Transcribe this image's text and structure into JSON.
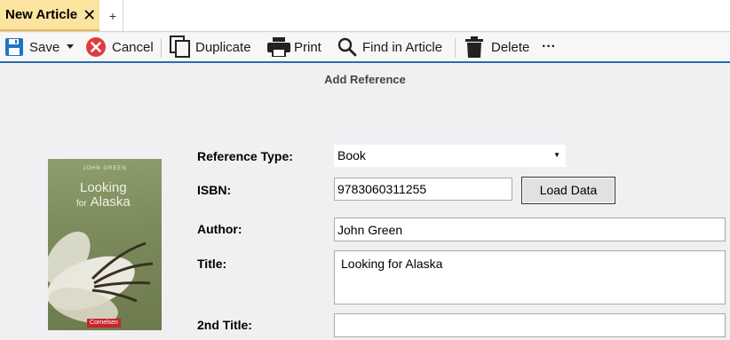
{
  "tabs": {
    "active_label": "New Article",
    "close_glyph": "✕",
    "add_glyph": "+"
  },
  "toolbar": {
    "save_label": "Save",
    "cancel_label": "Cancel",
    "duplicate_label": "Duplicate",
    "print_label": "Print",
    "find_label": "Find in Article",
    "delete_label": "Delete",
    "more_glyph": "···"
  },
  "colors": {
    "tab_active": "#fbe3a0",
    "accent_blue": "#2b6cb0",
    "cancel_red": "#e23b3b"
  },
  "page": {
    "heading": "Add Reference"
  },
  "cover": {
    "author": "JOHN GREEN",
    "title_line1": "Looking",
    "title_line2_prefix": "for",
    "title_line2": "Alaska",
    "publisher": "Cornelsen"
  },
  "form": {
    "reference_type_label": "Reference Type:",
    "reference_type_value": "Book",
    "isbn_label": "ISBN:",
    "isbn_value": "9783060311255",
    "load_data_label": "Load Data",
    "author_label": "Author:",
    "author_value": "John Green",
    "title_label": "Title:",
    "title_value": "Looking for Alaska",
    "second_title_label": "2nd Title:",
    "second_title_value": ""
  }
}
